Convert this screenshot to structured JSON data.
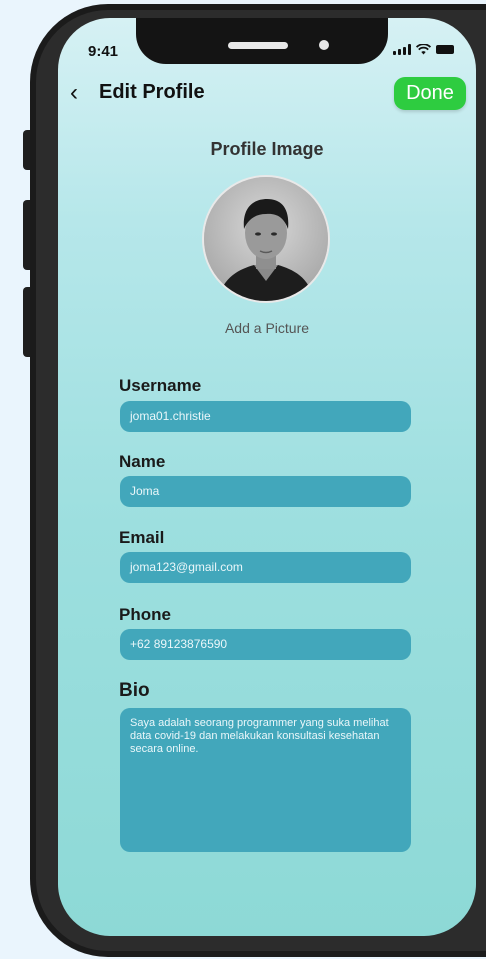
{
  "status_bar": {
    "time": "9:41"
  },
  "header": {
    "title": "Edit Profile",
    "done_label": "Done"
  },
  "profile": {
    "image_label": "Profile Image",
    "add_picture_label": "Add a Picture"
  },
  "form": {
    "username": {
      "label": "Username",
      "value": "joma01.christie"
    },
    "name": {
      "label": "Name",
      "value": "Joma"
    },
    "email": {
      "label": "Email",
      "value": "joma123@gmail.com"
    },
    "phone": {
      "label": "Phone",
      "value": "+62 89123876590"
    },
    "bio": {
      "label": "Bio",
      "value": "Saya adalah seorang programmer yang suka melihat data covid-19 dan melakukan konsultasi kesehatan secara online."
    }
  },
  "colors": {
    "accent": "#2ecc40",
    "field_bg": "#42a7bb"
  },
  "icons": {
    "back": "chevron-left-icon",
    "signal": "signal-icon",
    "wifi": "wifi-icon",
    "battery": "battery-icon"
  }
}
